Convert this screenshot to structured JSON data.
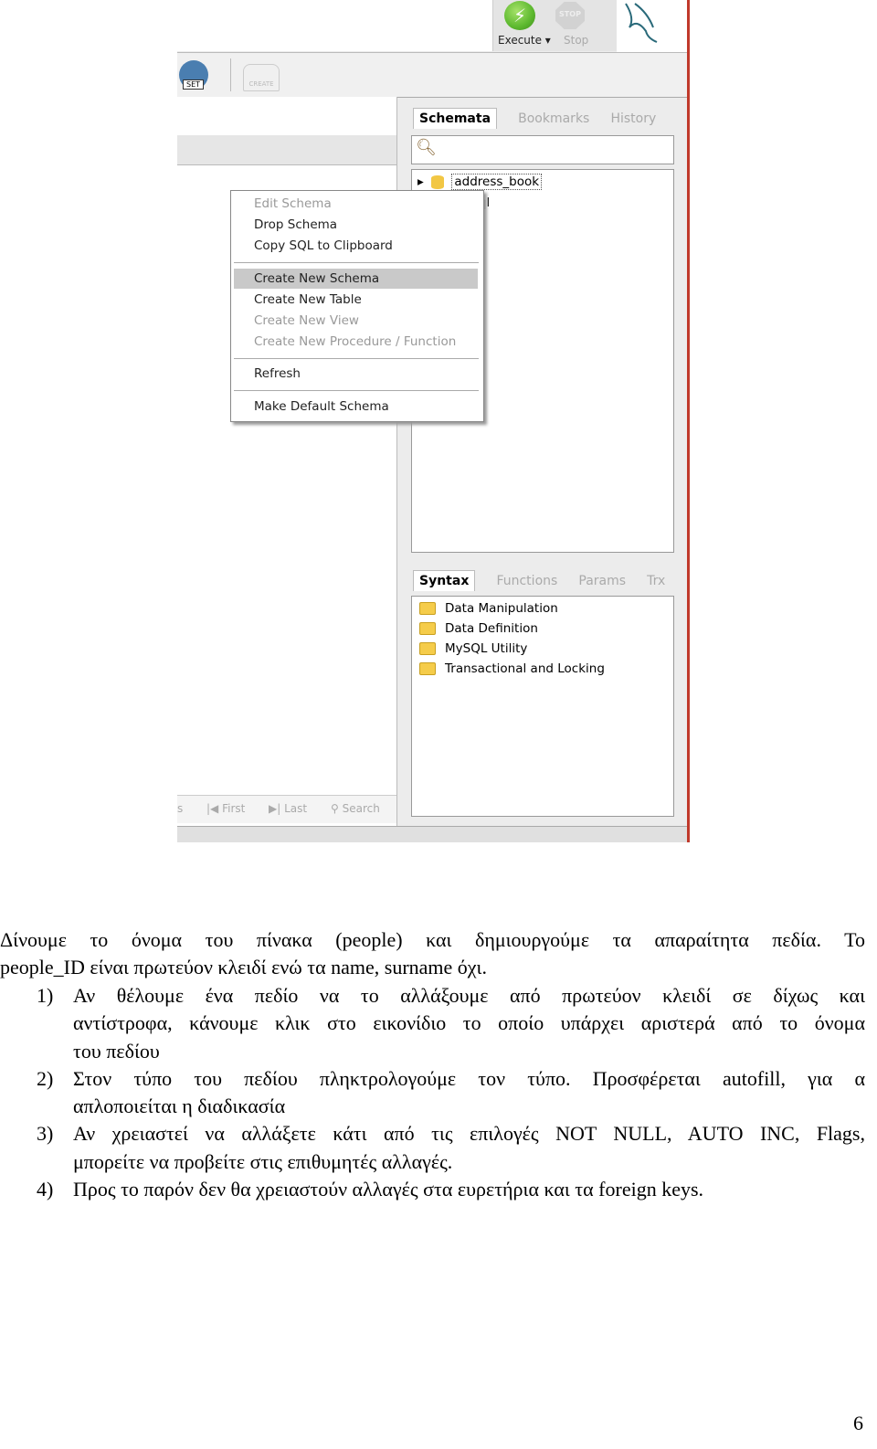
{
  "screenshot": {
    "toolbar": {
      "execute_label": "Execute ▾",
      "stop_label": "Stop",
      "stop_icon_text": "STOP",
      "set_label": "SET",
      "create_label": "CREATE"
    },
    "schema_tabs": [
      "Schemata",
      "Bookmarks",
      "History"
    ],
    "schema_tree": [
      "address_book",
      "...ql"
    ],
    "context_menu": [
      {
        "label": "Edit Schema",
        "enabled": false
      },
      {
        "label": "Drop Schema",
        "enabled": true
      },
      {
        "label": "Copy SQL to Clipboard",
        "enabled": true
      },
      {
        "label": "Create New Schema",
        "enabled": true,
        "highlighted": true
      },
      {
        "label": "Create New Table",
        "enabled": true
      },
      {
        "label": "Create New View",
        "enabled": false
      },
      {
        "label": "Create New Procedure / Function",
        "enabled": false
      },
      {
        "label": "Refresh",
        "enabled": true
      },
      {
        "label": "Make Default Schema",
        "enabled": true
      }
    ],
    "syntax_tabs": [
      "Syntax",
      "Functions",
      "Params",
      "Trx"
    ],
    "syntax_items": [
      "Data Manipulation",
      "Data Definition",
      "MySQL Utility",
      "Transactional and Locking"
    ],
    "nav_buttons": [
      "First",
      "Last",
      "Search"
    ],
    "colors": {
      "execute": "#5cb82e",
      "folder": "#f5cc4a",
      "highlight": "#c9c9c9"
    }
  },
  "text": {
    "intro_1": "Δίνουμε το όνομα του πίνακα (people) και δημιουργούμε τα απαραίτητα πεδία. Το",
    "intro_2": "people_ID είναι πρωτεύον κλειδί ενώ τα name, surname όχι.",
    "items": [
      {
        "num": "1)",
        "lines": [
          "Αν θέλουμε ένα πεδίο να το αλλάξουμε από πρωτεύον κλειδί σε δίχως και",
          "αντίστροφα, κάνουμε κλικ στο εικονίδιο το οποίο υπάρχει αριστερά από το όνομα",
          "του πεδίου"
        ]
      },
      {
        "num": "2)",
        "lines": [
          "Στον τύπο του πεδίου πληκτρολογούμε τον τύπο. Προσφέρεται autofill, για α",
          "απλοποιείται η διαδικασία"
        ]
      },
      {
        "num": "3)",
        "lines": [
          "Αν χρειαστεί να αλλάξετε κάτι από τις επιλογές NOT NULL, AUTO INC, Flags,",
          "μπορείτε να προβείτε στις επιθυμητές αλλαγές."
        ]
      },
      {
        "num": "4)",
        "lines": [
          "Προς το παρόν δεν θα χρειαστούν αλλαγές στα ευρετήρια και τα foreign keys."
        ]
      }
    ],
    "page_number": "6"
  }
}
